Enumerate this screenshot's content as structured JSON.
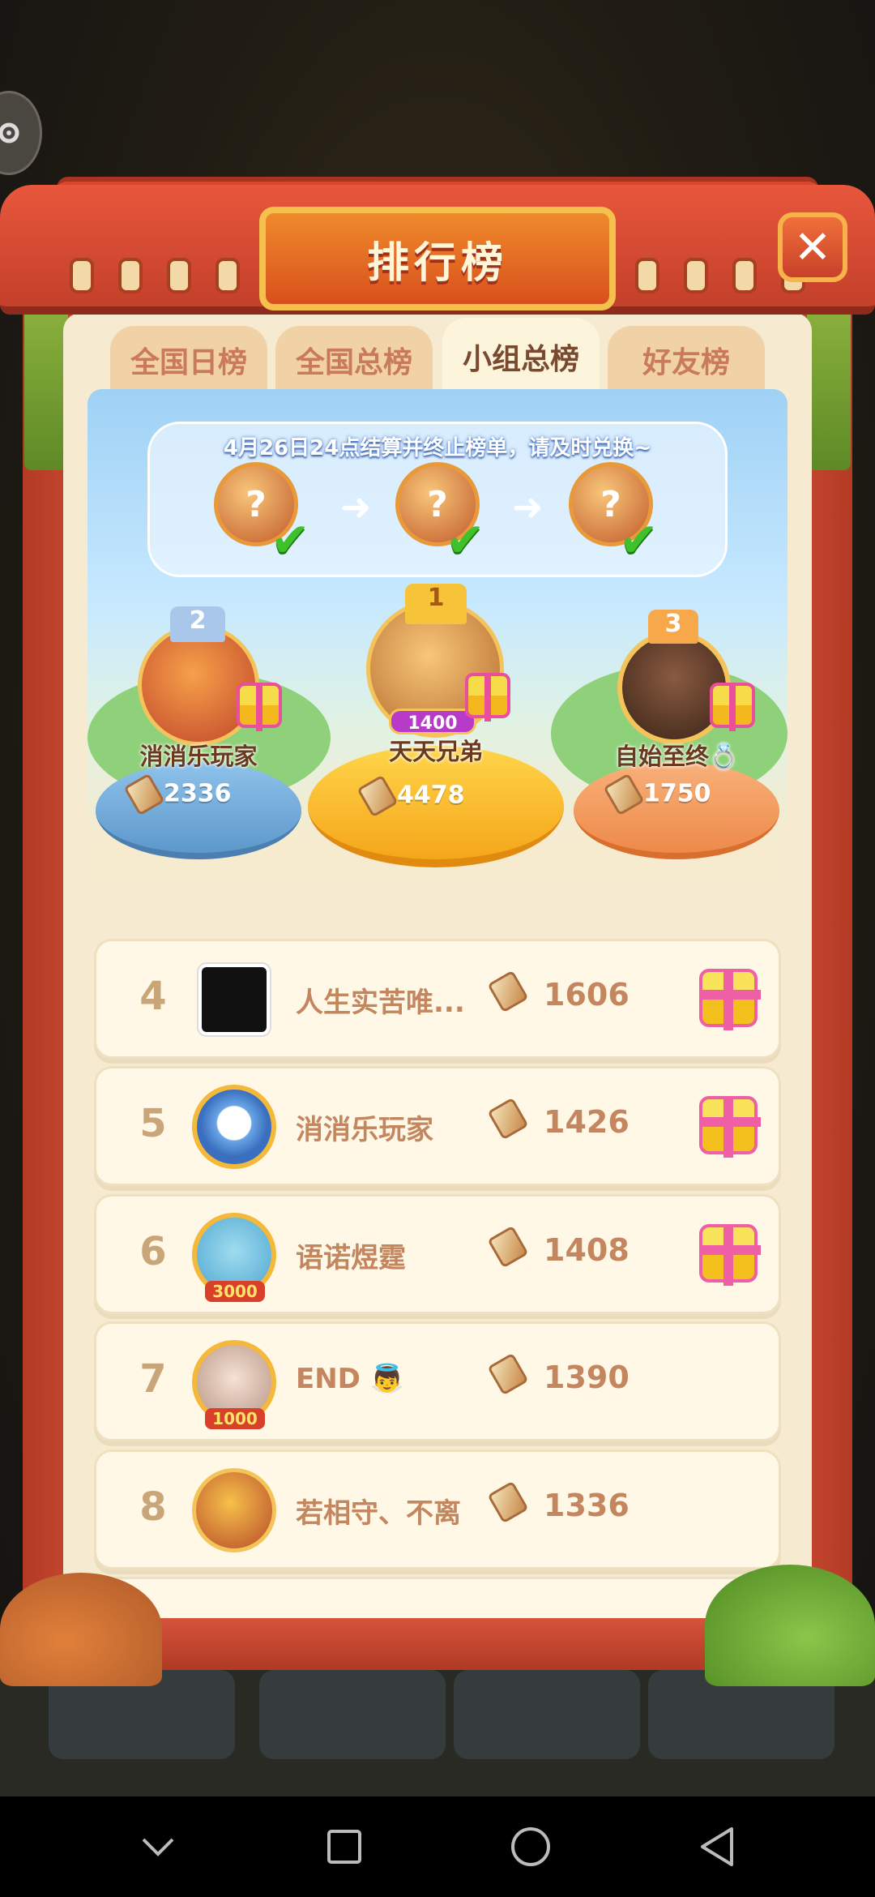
{
  "header": {
    "title": "排行榜"
  },
  "tabs": [
    {
      "label": "全国日榜",
      "active": false
    },
    {
      "label": "全国总榜",
      "active": false
    },
    {
      "label": "小组总榜",
      "active": true
    },
    {
      "label": "好友榜",
      "active": false
    }
  ],
  "notice": {
    "text": "4月26日24点结算并终止榜单，请及时兑换~"
  },
  "podium": {
    "first": {
      "rank": "1",
      "name": "天天兄弟",
      "score": "4478",
      "badge": "1400"
    },
    "second": {
      "rank": "2",
      "name": "消消乐玩家",
      "score": "2336"
    },
    "third": {
      "rank": "3",
      "name": "自始至终💍",
      "score": "1750"
    }
  },
  "rows": [
    {
      "rank": "4",
      "name": "人生实苦唯...",
      "score": "1606",
      "gift": true
    },
    {
      "rank": "5",
      "name": "消消乐玩家",
      "score": "1426",
      "gift": true
    },
    {
      "rank": "6",
      "name": "语诺煜霆",
      "score": "1408",
      "gift": true,
      "frame_badge": "3000"
    },
    {
      "rank": "7",
      "name": "END 👼",
      "score": "1390",
      "gift": false,
      "frame_badge": "1000"
    },
    {
      "rank": "8",
      "name": "若相守、不离",
      "score": "1336",
      "gift": false
    }
  ],
  "colors": {
    "accent": "#d7523a",
    "panel": "#f6ead0",
    "gold": "#f5c04c",
    "text_brown": "#c4865e"
  }
}
